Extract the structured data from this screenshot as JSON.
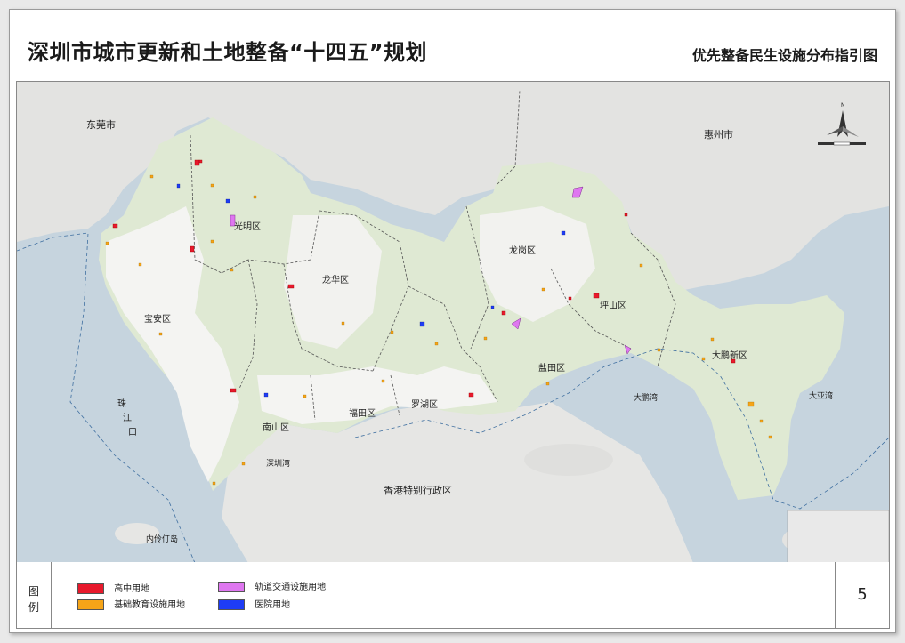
{
  "header": {
    "main_title": "深圳市城市更新和土地整备“十四五”规划",
    "sub_title": "优先整备民生设施分布指引图"
  },
  "map": {
    "place_labels": {
      "dongguan": "东莞市",
      "huizhou": "惠州市",
      "guangming": "光明区",
      "baoan": "宝安区",
      "longhua": "龙华区",
      "longgang": "龙岗区",
      "pingshan": "坪山区",
      "dapeng": "大鹏新区",
      "yantian": "盐田区",
      "luohu": "罗湖区",
      "futian": "福田区",
      "nanshan": "南山区",
      "shenzhen_bay": "深圳湾",
      "hongkong": "香港特别行政区",
      "neilingding": "内伶仃岛",
      "dapeng_bay": "大鹏湾",
      "daya_bay": "大亚湾",
      "zhujiang_1": "珠",
      "zhujiang_2": "江",
      "zhujiang_3": "口"
    },
    "north_label": "N"
  },
  "legend": {
    "title_1": "图",
    "title_2": "例",
    "items": [
      {
        "label": "高中用地",
        "color": "#e8192c"
      },
      {
        "label": "轨道交通设施用地",
        "color": "#df77f0"
      },
      {
        "label": "基础教育设施用地",
        "color": "#f5a418"
      },
      {
        "label": "医院用地",
        "color": "#1e3cf5"
      }
    ]
  },
  "page_number": "5"
}
